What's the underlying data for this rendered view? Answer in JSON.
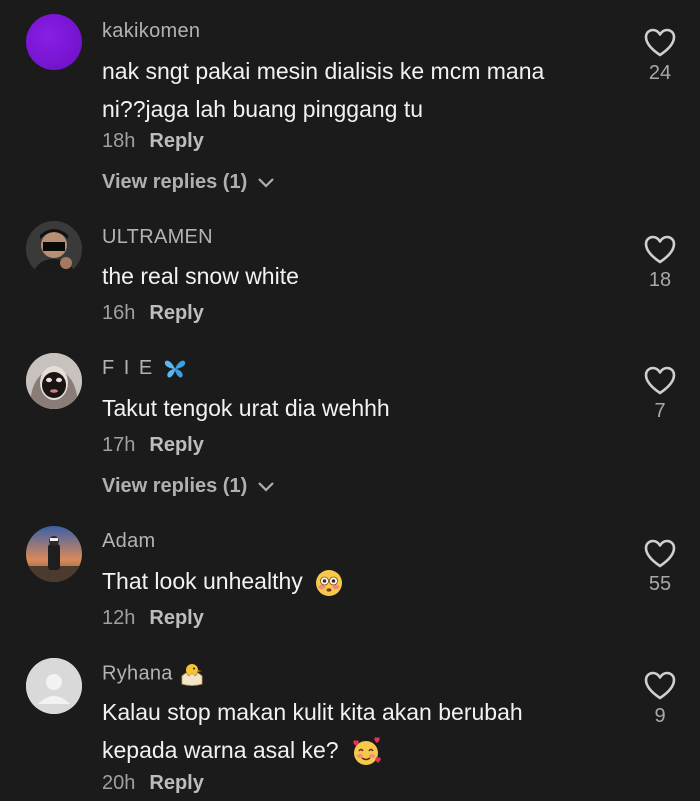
{
  "comments": [
    {
      "username": "kakikomen",
      "text_lines": [
        "nak sngt pakai mesin dialisis ke mcm mana",
        "ni??jaga lah buang pinggang tu"
      ],
      "time": "18h",
      "reply_label": "Reply",
      "view_replies": "View replies (1)",
      "likes": "24",
      "avatar": "purple-circle-avatar"
    },
    {
      "username": "ULTRAMEN",
      "text_lines": [
        "the real snow white"
      ],
      "time": "16h",
      "reply_label": "Reply",
      "likes": "18",
      "avatar": "masked-man-photo-avatar"
    },
    {
      "username": "F I E",
      "username_icon": "blue-butterfly-icon",
      "text_lines": [
        "Takut tengok urat dia wehhh"
      ],
      "time": "17h",
      "reply_label": "Reply",
      "view_replies": "View replies (1)",
      "likes": "7",
      "avatar": "face-mask-photo-avatar"
    },
    {
      "username": "Adam",
      "text_lines": [
        "That look unhealthy"
      ],
      "text_emoji": "flushed-face-emoji",
      "time": "12h",
      "reply_label": "Reply",
      "likes": "55",
      "avatar": "sunset-figure-photo-avatar"
    },
    {
      "username": "Ryhana",
      "username_icon": "hatching-chick-emoji",
      "text_lines": [
        "Kalau stop makan kulit kita akan berubah",
        "kepada warna asal ke?"
      ],
      "text_emoji": "smiling-face-with-hearts-emoji",
      "time": "20h",
      "reply_label": "Reply",
      "likes": "9",
      "avatar": "default-gray-avatar"
    }
  ],
  "colors": {
    "background": "#1b1b1b",
    "text": "#f2f2f2",
    "username": "#b3b3b3",
    "meta": "#a0a0a0"
  }
}
